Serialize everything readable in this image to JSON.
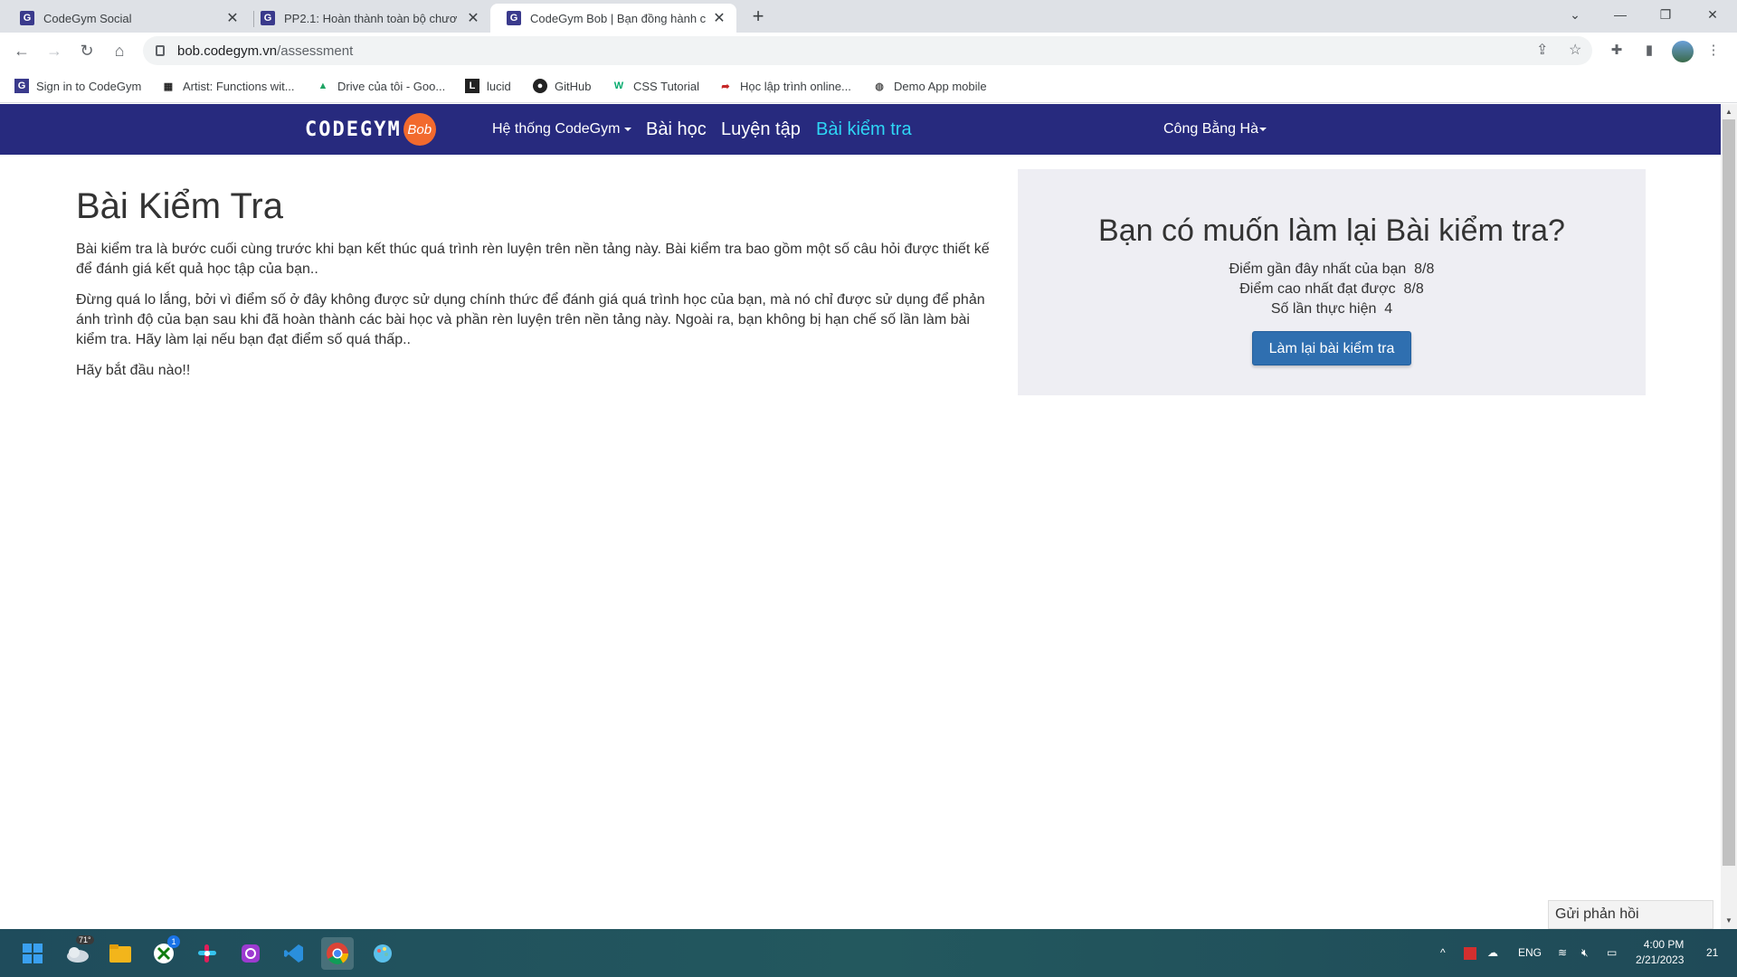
{
  "browser": {
    "tabs": [
      {
        "title": "CodeGym Social",
        "active": false
      },
      {
        "title": "PP2.1: Hoàn thành toàn bộ chươ",
        "active": false
      },
      {
        "title": "CodeGym Bob | Bạn đồng hành c",
        "active": true
      }
    ],
    "url_host": "bob.codegym.vn",
    "url_path": "/assessment",
    "bookmarks": [
      {
        "label": "Sign in to CodeGym",
        "icon": "codegym-icon"
      },
      {
        "label": "Artist: Functions wit...",
        "icon": "grid-icon"
      },
      {
        "label": "Drive của tôi - Goo...",
        "icon": "google-drive-icon"
      },
      {
        "label": "lucid",
        "icon": "lucid-icon"
      },
      {
        "label": "GitHub",
        "icon": "github-icon"
      },
      {
        "label": "CSS Tutorial",
        "icon": "w3schools-icon"
      },
      {
        "label": "Học lập trình online...",
        "icon": "arrow-icon"
      },
      {
        "label": "Demo App mobile",
        "icon": "globe-icon"
      }
    ]
  },
  "site": {
    "logo_text": "CODEGYM",
    "logo_badge": "Bob",
    "nav": {
      "system": "Hệ thống CodeGym",
      "lessons": "Bài học",
      "practice": "Luyện tập",
      "assessment": "Bài kiểm tra",
      "user": "Công Bằng Hà"
    }
  },
  "main": {
    "title": "Bài Kiểm Tra",
    "p1": "Bài kiểm tra là bước cuối cùng trước khi bạn kết thúc quá trình rèn luyện trên nền tảng này. Bài kiểm tra bao gồm một số câu hỏi được thiết kế để đánh giá kết quả học tập của bạn..",
    "p2": "Đừng quá lo lắng, bởi vì điểm số ở đây không được sử dụng chính thức để đánh giá quá trình học của bạn, mà nó chỉ được sử dụng để phản ánh trình độ của bạn sau khi đã hoàn thành các bài học và phần rèn luyện trên nền tảng này. Ngoài ra, bạn không bị hạn chế số lần làm bài kiểm tra. Hãy làm lại nếu bạn đạt điểm số quá thấp..",
    "p3": "Hãy bắt đầu nào!!"
  },
  "panel": {
    "title": "Bạn có muốn làm lại Bài kiểm tra?",
    "recent_label": "Điểm gần đây nhất của bạn",
    "recent_value": "8/8",
    "best_label": "Điểm cao nhất đạt được",
    "best_value": "8/8",
    "attempts_label": "Số lần thực hiện",
    "attempts_value": "4",
    "retry_button": "Làm lại bài kiểm tra"
  },
  "feedback_button": "Gửi phản hồi",
  "taskbar": {
    "weather_badge": "71°",
    "xbox_badge": "1",
    "lang": "ENG",
    "time": "4:00 PM",
    "date": "2/21/2023",
    "notif": "21"
  }
}
